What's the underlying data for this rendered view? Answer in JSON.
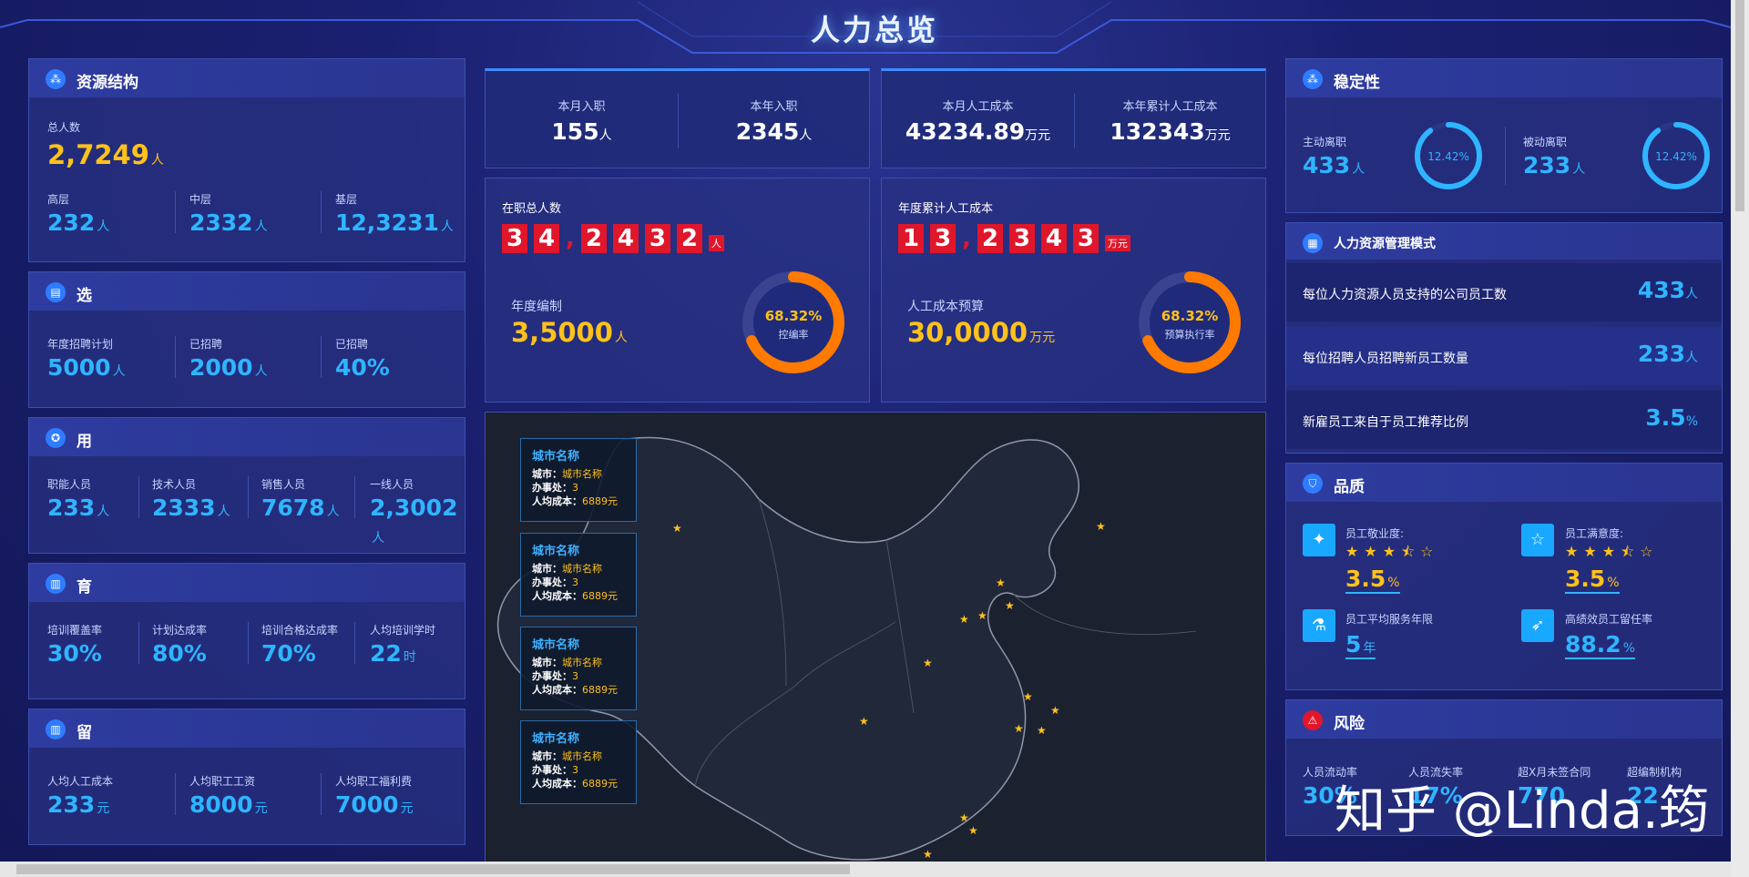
{
  "title": "人力总览",
  "resource": {
    "header": "资源结构",
    "total_label": "总人数",
    "total_value": "2,7249",
    "total_unit": "人",
    "items": [
      {
        "label": "高层",
        "value": "232",
        "unit": "人"
      },
      {
        "label": "中层",
        "value": "2332",
        "unit": "人"
      },
      {
        "label": "基层",
        "value": "12,3231",
        "unit": "人"
      }
    ]
  },
  "select": {
    "header": "选",
    "items": [
      {
        "label": "年度招聘计划",
        "value": "5000",
        "unit": "人"
      },
      {
        "label": "已招聘",
        "value": "2000",
        "unit": "人"
      },
      {
        "label": "已招聘",
        "value": "40%",
        "unit": ""
      }
    ]
  },
  "use": {
    "header": "用",
    "items": [
      {
        "label": "职能人员",
        "value": "233",
        "unit": "人"
      },
      {
        "label": "技术人员",
        "value": "2333",
        "unit": "人"
      },
      {
        "label": "销售人员",
        "value": "7678",
        "unit": "人"
      },
      {
        "label": "一线人员",
        "value": "2,3002",
        "unit": "人"
      }
    ]
  },
  "train": {
    "header": "育",
    "items": [
      {
        "label": "培训覆盖率",
        "value": "30%",
        "unit": ""
      },
      {
        "label": "计划达成率",
        "value": "80%",
        "unit": ""
      },
      {
        "label": "培训合格达成率",
        "value": "70%",
        "unit": ""
      },
      {
        "label": "人均培训学时",
        "value": "22",
        "unit": "时"
      }
    ]
  },
  "retain": {
    "header": "留",
    "items": [
      {
        "label": "人均人工成本",
        "value": "233",
        "unit": "元"
      },
      {
        "label": "人均职工工资",
        "value": "8000",
        "unit": "元"
      },
      {
        "label": "人均职工福利费",
        "value": "7000",
        "unit": "元"
      }
    ]
  },
  "hires": [
    {
      "label": "本月入职",
      "value": "155",
      "unit": "人"
    },
    {
      "label": "本年入职",
      "value": "2345",
      "unit": "人"
    }
  ],
  "cost": [
    {
      "label": "本月人工成本",
      "value": "43234.89",
      "unit": "万元"
    },
    {
      "label": "本年累计人工成本",
      "value": "132343",
      "unit": "万元"
    }
  ],
  "headcount": {
    "label": "在职总人数",
    "digits": [
      "3",
      "4",
      ",",
      "2",
      "4",
      "3",
      "2"
    ],
    "unit": "人",
    "sub_label": "年度编制",
    "sub_value": "3,5000",
    "sub_unit": "人",
    "gauge_value": "68.32%",
    "gauge_label": "控编率",
    "gauge_pct": 68.32
  },
  "annualcost": {
    "label": "年度累计人工成本",
    "digits": [
      "1",
      "3",
      ",",
      "2",
      "3",
      "4",
      "3"
    ],
    "unit": "万元",
    "sub_label": "人工成本预算",
    "sub_value": "30,0000",
    "sub_unit": "万元",
    "gauge_value": "68.32%",
    "gauge_label": "预算执行率",
    "gauge_pct": 68.32
  },
  "map_cards": [
    {
      "title": "城市名称",
      "city_label": "城市：",
      "city": "城市名称",
      "office_label": "办事处：",
      "office": "3",
      "cost_label": "人均成本：",
      "cost": "6889元"
    },
    {
      "title": "城市名称",
      "city_label": "城市：",
      "city": "城市名称",
      "office_label": "办事处：",
      "office": "3",
      "cost_label": "人均成本：",
      "cost": "6889元"
    },
    {
      "title": "城市名称",
      "city_label": "城市：",
      "city": "城市名称",
      "office_label": "办事处：",
      "office": "3",
      "cost_label": "人均成本：",
      "cost": "6889元"
    },
    {
      "title": "城市名称",
      "city_label": "城市：",
      "city": "城市名称",
      "office_label": "办事处：",
      "office": "3",
      "cost_label": "人均成本：",
      "cost": "6889元"
    }
  ],
  "stability": {
    "header": "稳定性",
    "items": [
      {
        "label": "主动离职",
        "value": "433",
        "unit": "人",
        "pct": "12.42%",
        "ratio": 0.1242
      },
      {
        "label": "被动离职",
        "value": "233",
        "unit": "人",
        "pct": "12.42%",
        "ratio": 0.1242
      }
    ]
  },
  "hrmode": {
    "header": "人力资源管理模式",
    "rows": [
      {
        "label": "每位人力资源人员支持的公司员工数",
        "value": "433",
        "unit": "人"
      },
      {
        "label": "每位招聘人员招聘新员工数量",
        "value": "233",
        "unit": "人"
      },
      {
        "label": "新雇员工来自于员工推荐比例",
        "value": "3.5",
        "unit": "%"
      }
    ]
  },
  "quality": {
    "header": "品质",
    "items": [
      {
        "label": "员工敬业度:",
        "value": "3.5",
        "unit": "%",
        "stars": "★★★⯪☆"
      },
      {
        "label": "员工满意度:",
        "value": "3.5",
        "unit": "%",
        "stars": "★★★⯪☆"
      },
      {
        "label": "员工平均服务年限",
        "value": "5",
        "unit": "年",
        "stars": ""
      },
      {
        "label": "高绩效员工留任率",
        "value": "88.2",
        "unit": "%",
        "stars": ""
      }
    ]
  },
  "risk": {
    "header": "风险",
    "items": [
      {
        "label": "人员流动率",
        "value": "30%"
      },
      {
        "label": "人员流失率",
        "value": "17%"
      },
      {
        "label": "超X月未签合同",
        "value": "770"
      },
      {
        "label": "超编制机构",
        "value": "22"
      }
    ]
  },
  "watermark": "知乎 @Linda.筠",
  "colors": {
    "accent": "#2fb5ff",
    "highlight": "#ffc21a",
    "digit": "#e0162b",
    "gauge": "#ff7a00"
  }
}
